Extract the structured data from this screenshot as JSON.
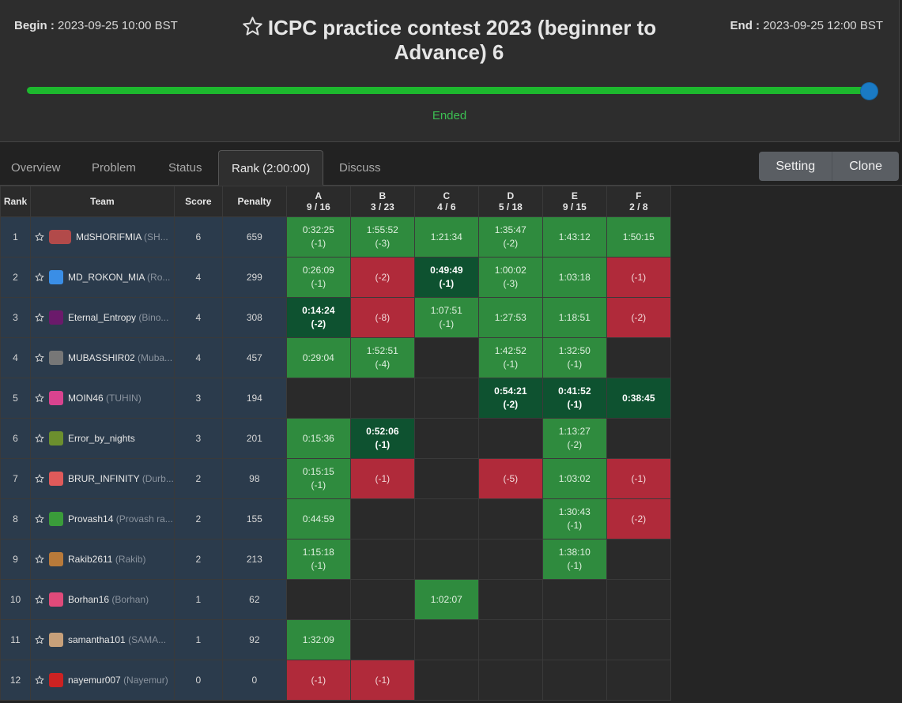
{
  "contest": {
    "begin_label": "Begin :",
    "begin_value": "2023-09-25 10:00 BST",
    "end_label": "End :",
    "end_value": "2023-09-25 12:00 BST",
    "title": "ICPC practice contest 2023 (beginner to Advance) 6",
    "status": "Ended",
    "progress_percent": 100
  },
  "tabs": [
    "Overview",
    "Problem",
    "Status",
    "Rank (2:00:00)",
    "Discuss"
  ],
  "active_tab": "Rank (2:00:00)",
  "buttons": {
    "setting": "Setting",
    "clone": "Clone"
  },
  "colors": {
    "accepted": "#2f8b3e",
    "first_solve": "#0e5230",
    "wrong": "#b02a3a",
    "progress": "#1db82e",
    "handle": "#1a7ac4"
  },
  "table": {
    "headers": {
      "rank": "Rank",
      "team": "Team",
      "score": "Score",
      "penalty": "Penalty"
    },
    "problems": [
      {
        "id": "A",
        "stat": "9 / 16"
      },
      {
        "id": "B",
        "stat": "3 / 23"
      },
      {
        "id": "C",
        "stat": "4 / 6"
      },
      {
        "id": "D",
        "stat": "5 / 18"
      },
      {
        "id": "E",
        "stat": "9 / 15"
      },
      {
        "id": "F",
        "stat": "2 / 8"
      }
    ],
    "rows": [
      {
        "rank": "1",
        "name": "MdSHORIFMIA",
        "nick": "(SH...",
        "avatar": "ref-avatar",
        "score": "6",
        "penalty": "659",
        "cells": [
          {
            "s": "ac",
            "t": "0:32:25",
            "a": "(-1)"
          },
          {
            "s": "ac",
            "t": "1:55:52",
            "a": "(-3)"
          },
          {
            "s": "ac",
            "t": "1:21:34",
            "a": ""
          },
          {
            "s": "ac",
            "t": "1:35:47",
            "a": "(-2)"
          },
          {
            "s": "ac",
            "t": "1:43:12",
            "a": ""
          },
          {
            "s": "ac",
            "t": "1:50:15",
            "a": ""
          }
        ]
      },
      {
        "rank": "2",
        "name": "MD_ROKON_MIA",
        "nick": "(Ro...",
        "avatar": "finder-avatar",
        "score": "4",
        "penalty": "299",
        "cells": [
          {
            "s": "ac",
            "t": "0:26:09",
            "a": "(-1)"
          },
          {
            "s": "wa",
            "t": "",
            "a": "(-2)"
          },
          {
            "s": "first",
            "t": "0:49:49",
            "a": "(-1)"
          },
          {
            "s": "ac",
            "t": "1:00:02",
            "a": "(-3)"
          },
          {
            "s": "ac",
            "t": "1:03:18",
            "a": ""
          },
          {
            "s": "wa",
            "t": "",
            "a": "(-1)"
          }
        ]
      },
      {
        "rank": "3",
        "name": "Eternal_Entropy",
        "nick": "(Bino...",
        "avatar": "pixel-avatar",
        "score": "4",
        "penalty": "308",
        "cells": [
          {
            "s": "first",
            "t": "0:14:24",
            "a": "(-2)"
          },
          {
            "s": "wa",
            "t": "",
            "a": "(-8)"
          },
          {
            "s": "ac",
            "t": "1:07:51",
            "a": "(-1)"
          },
          {
            "s": "ac",
            "t": "1:27:53",
            "a": ""
          },
          {
            "s": "ac",
            "t": "1:18:51",
            "a": ""
          },
          {
            "s": "wa",
            "t": "",
            "a": "(-2)"
          }
        ]
      },
      {
        "rank": "4",
        "name": "MUBASSHIR02",
        "nick": "(Muba...",
        "avatar": "photo-avatar",
        "score": "4",
        "penalty": "457",
        "cells": [
          {
            "s": "ac",
            "t": "0:29:04",
            "a": ""
          },
          {
            "s": "ac",
            "t": "1:52:51",
            "a": "(-4)"
          },
          {
            "s": "empty",
            "t": "",
            "a": ""
          },
          {
            "s": "ac",
            "t": "1:42:52",
            "a": "(-1)"
          },
          {
            "s": "ac",
            "t": "1:32:50",
            "a": "(-1)"
          },
          {
            "s": "empty",
            "t": "",
            "a": ""
          }
        ]
      },
      {
        "rank": "5",
        "name": "MOIN46",
        "nick": "(TUHIN)",
        "avatar": "pink-avatar",
        "score": "3",
        "penalty": "194",
        "cells": [
          {
            "s": "empty",
            "t": "",
            "a": ""
          },
          {
            "s": "empty",
            "t": "",
            "a": ""
          },
          {
            "s": "empty",
            "t": "",
            "a": ""
          },
          {
            "s": "first",
            "t": "0:54:21",
            "a": "(-2)"
          },
          {
            "s": "first",
            "t": "0:41:52",
            "a": "(-1)"
          },
          {
            "s": "first",
            "t": "0:38:45",
            "a": ""
          }
        ]
      },
      {
        "rank": "6",
        "name": "Error_by_nights",
        "nick": "",
        "avatar": "creeper-avatar",
        "score": "3",
        "penalty": "201",
        "cells": [
          {
            "s": "ac",
            "t": "0:15:36",
            "a": ""
          },
          {
            "s": "first",
            "t": "0:52:06",
            "a": "(-1)"
          },
          {
            "s": "empty",
            "t": "",
            "a": ""
          },
          {
            "s": "empty",
            "t": "",
            "a": ""
          },
          {
            "s": "ac",
            "t": "1:13:27",
            "a": "(-2)"
          },
          {
            "s": "empty",
            "t": "",
            "a": ""
          }
        ]
      },
      {
        "rank": "7",
        "name": "BRUR_INFINITY",
        "nick": "(Durb...",
        "avatar": "cartoon-avatar",
        "score": "2",
        "penalty": "98",
        "cells": [
          {
            "s": "ac",
            "t": "0:15:15",
            "a": "(-1)"
          },
          {
            "s": "wa",
            "t": "",
            "a": "(-1)"
          },
          {
            "s": "empty",
            "t": "",
            "a": ""
          },
          {
            "s": "wa",
            "t": "",
            "a": "(-5)"
          },
          {
            "s": "ac",
            "t": "1:03:02",
            "a": ""
          },
          {
            "s": "wa",
            "t": "",
            "a": "(-1)"
          }
        ]
      },
      {
        "rank": "8",
        "name": "Provash14",
        "nick": "(Provash ra...",
        "avatar": "identicon-avatar",
        "score": "2",
        "penalty": "155",
        "cells": [
          {
            "s": "ac",
            "t": "0:44:59",
            "a": ""
          },
          {
            "s": "empty",
            "t": "",
            "a": ""
          },
          {
            "s": "empty",
            "t": "",
            "a": ""
          },
          {
            "s": "empty",
            "t": "",
            "a": ""
          },
          {
            "s": "ac",
            "t": "1:30:43",
            "a": "(-1)"
          },
          {
            "s": "wa",
            "t": "",
            "a": "(-2)"
          }
        ]
      },
      {
        "rank": "9",
        "name": "Rakib2611",
        "nick": "(Rakib)",
        "avatar": "face-avatar",
        "score": "2",
        "penalty": "213",
        "cells": [
          {
            "s": "ac",
            "t": "1:15:18",
            "a": "(-1)"
          },
          {
            "s": "empty",
            "t": "",
            "a": ""
          },
          {
            "s": "empty",
            "t": "",
            "a": ""
          },
          {
            "s": "empty",
            "t": "",
            "a": ""
          },
          {
            "s": "ac",
            "t": "1:38:10",
            "a": "(-1)"
          },
          {
            "s": "empty",
            "t": "",
            "a": ""
          }
        ]
      },
      {
        "rank": "10",
        "name": "Borhan16",
        "nick": "(Borhan)",
        "avatar": "heart-avatar",
        "score": "1",
        "penalty": "62",
        "cells": [
          {
            "s": "empty",
            "t": "",
            "a": ""
          },
          {
            "s": "empty",
            "t": "",
            "a": ""
          },
          {
            "s": "ac",
            "t": "1:02:07",
            "a": ""
          },
          {
            "s": "empty",
            "t": "",
            "a": ""
          },
          {
            "s": "empty",
            "t": "",
            "a": ""
          },
          {
            "s": "empty",
            "t": "",
            "a": ""
          }
        ]
      },
      {
        "rank": "11",
        "name": "samantha101",
        "nick": "(SAMA...",
        "avatar": "animal-avatar",
        "score": "1",
        "penalty": "92",
        "cells": [
          {
            "s": "ac",
            "t": "1:32:09",
            "a": ""
          },
          {
            "s": "empty",
            "t": "",
            "a": ""
          },
          {
            "s": "empty",
            "t": "",
            "a": ""
          },
          {
            "s": "empty",
            "t": "",
            "a": ""
          },
          {
            "s": "empty",
            "t": "",
            "a": ""
          },
          {
            "s": "empty",
            "t": "",
            "a": ""
          }
        ]
      },
      {
        "rank": "12",
        "name": "nayemur007",
        "nick": "(Nayemur)",
        "avatar": "red-figure-avatar",
        "score": "0",
        "penalty": "0",
        "cells": [
          {
            "s": "wa",
            "t": "",
            "a": "(-1)"
          },
          {
            "s": "wa",
            "t": "",
            "a": "(-1)"
          },
          {
            "s": "empty",
            "t": "",
            "a": ""
          },
          {
            "s": "empty",
            "t": "",
            "a": ""
          },
          {
            "s": "empty",
            "t": "",
            "a": ""
          },
          {
            "s": "empty",
            "t": "",
            "a": ""
          }
        ]
      }
    ]
  }
}
